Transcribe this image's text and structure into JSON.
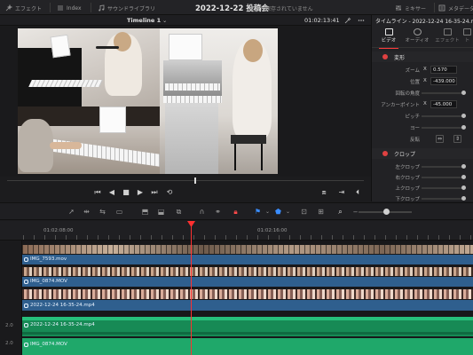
{
  "topbar": {
    "effects_label": "エフェクト",
    "index_label": "Index",
    "sound_library_label": "サウンドライブラリ",
    "project_title": "2022-12-22 投稿会",
    "unsaved_text": "変更が保存されていません",
    "mixer_label": "ミキサー",
    "metadata_label": "メタデータ"
  },
  "viewer": {
    "timeline_name": "Timeline 1",
    "timecode": "01:02:13:41"
  },
  "inspector": {
    "title": "タイムライン - 2022-12-24 16-35-24.mp4",
    "tabs": [
      {
        "label": "ビデオ",
        "active": true
      },
      {
        "label": "オーディオ",
        "active": false
      },
      {
        "label": "エフェクト",
        "active": false
      },
      {
        "label": "ト",
        "active": false
      }
    ],
    "transform": {
      "section_label": "変形",
      "zoom_label": "ズーム",
      "zoom_axis": "X",
      "zoom_value": "0.570",
      "position_label": "位置",
      "position_axis": "X",
      "position_value": "-439.000",
      "rotation_label": "回転の角度",
      "anchor_label": "アンカーポイント",
      "anchor_axis": "X",
      "anchor_value": "-45.000",
      "pitch_label": "ピッチ",
      "yaw_label": "ヨー",
      "flip_label": "反転"
    },
    "crop": {
      "section_label": "クロップ",
      "left_label": "左クロップ",
      "right_label": "右クロップ",
      "top_label": "上クロップ",
      "bottom_label": "下クロップ"
    }
  },
  "timeline": {
    "ruler_tc_1": "01:02:08:00",
    "ruler_tc_2": "01:02:16:00",
    "clips": [
      {
        "name": "IMG_7593.mov"
      },
      {
        "name": "IMG_0874.MOV"
      },
      {
        "name": "2022-12-24 16-35-24.mp4"
      },
      {
        "name": "2022-12-24 16-35-24.mp4"
      },
      {
        "name": "IMG_0874.MOV"
      }
    ],
    "audio_track_1": "2.0",
    "audio_track_2": "2.0"
  }
}
